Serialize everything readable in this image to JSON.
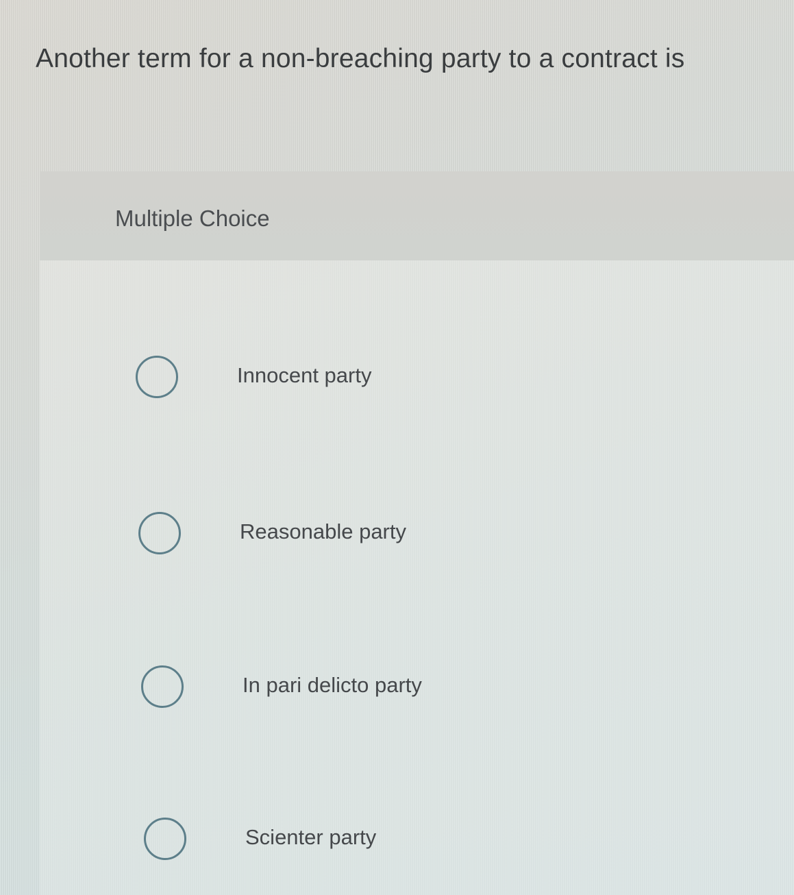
{
  "question": {
    "text": "Another term for a non-breaching party to a contract is"
  },
  "question_type": "Multiple Choice",
  "options": [
    {
      "label": "Innocent party",
      "selected": false
    },
    {
      "label": "Reasonable party",
      "selected": false
    },
    {
      "label": "In pari delicto party",
      "selected": false
    },
    {
      "label": "Scienter party",
      "selected": false
    }
  ],
  "colors": {
    "radio_border": "#5d7f8a",
    "text": "#45484b"
  }
}
